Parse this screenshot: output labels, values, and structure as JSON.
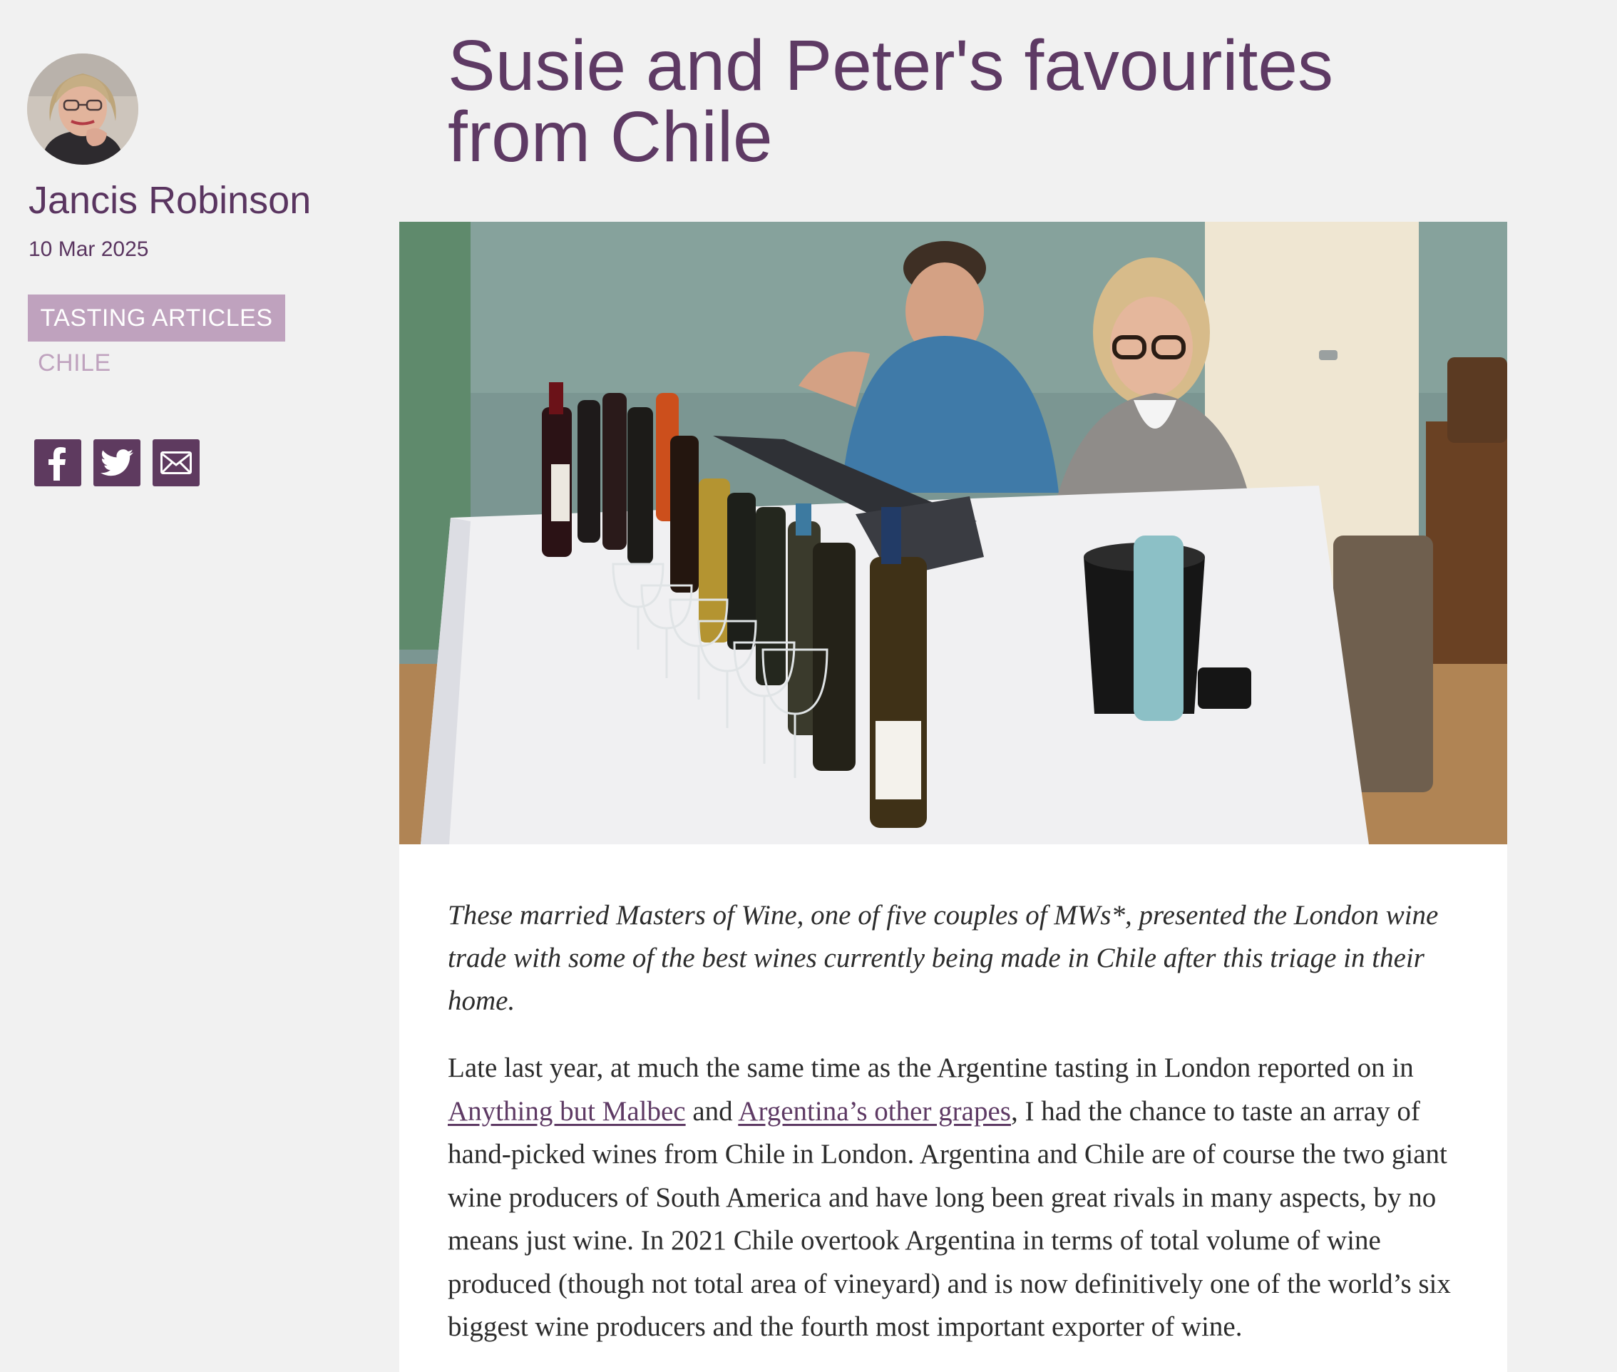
{
  "author": {
    "name": "Jancis Robinson",
    "date": "10 Mar 2025"
  },
  "tags": {
    "primary": "TASTING ARTICLES",
    "secondary": "CHILE"
  },
  "share": {
    "icons": [
      "facebook-icon",
      "twitter-icon",
      "email-icon"
    ]
  },
  "article": {
    "title": "Susie and Peter's favourites from Chile",
    "standfirst": "These married Masters of Wine, one of five couples of MWs*, presented the London wine trade with some of the best wines currently being made in Chile after this triage in their home.",
    "body": {
      "intro": "Late last year, at much the same time as the Argentine tasting in London reported on in",
      "link1": "Anything but Malbec",
      "and": "and",
      "link2": "Argentina’s other grapes",
      "rest": ", I had the chance to taste an array of hand-picked wines from Chile in London. Argentina and Chile are of course the two giant wine producers of South America and have long been great rivals in many aspects, by no means just wine. In 2021 Chile overtook Argentina in terms of total volume of wine produced (though not total area of vineyard) and is now definitively one of the world’s six biggest wine producers and the fourth most important exporter of wine."
    }
  },
  "colors": {
    "brand": "#5e3a64",
    "tag_bg": "#bfa2be",
    "page_bg": "#f1f1f1"
  }
}
